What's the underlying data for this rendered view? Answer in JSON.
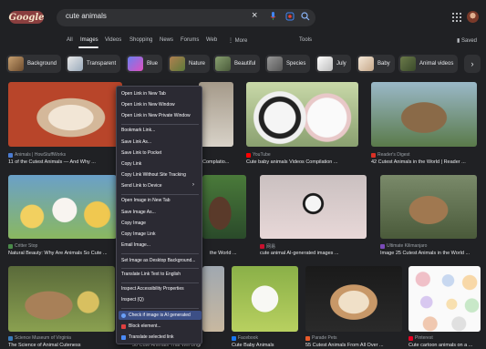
{
  "header": {
    "logo": "Google",
    "search_query": "cute animals",
    "clear_label": "×",
    "tools": "Tools",
    "saved": "Saved"
  },
  "nav": {
    "tabs": [
      "All",
      "Images",
      "Videos",
      "Shopping",
      "News",
      "Forums",
      "Web",
      "⋮ More"
    ],
    "active": "Images"
  },
  "chips": [
    "Background",
    "Transparent",
    "Blue",
    "Nature",
    "Beautiful",
    "Species",
    "July",
    "Baby",
    "Animal videos"
  ],
  "results": [
    {
      "source": "Animals | HowStuffWorks",
      "title": "11 of the Cutest Animals — And Why ..."
    },
    {
      "source": "",
      "title": "Complatio..."
    },
    {
      "source": "YouTube",
      "title": "Cute baby animals Videos Compilation ..."
    },
    {
      "source": "Reader's Digest",
      "title": "42 Cutest Animals in the World | Reader ..."
    },
    {
      "source": "Critter Stop",
      "title": "Natural Beauty: Why Are Animals So Cute ..."
    },
    {
      "source": "",
      "title": "the World ..."
    },
    {
      "source": "网易",
      "title": "cute animal AI-generated images ..."
    },
    {
      "source": "Ultimate Kilimanjaro",
      "title": "Image 25 Cutest Animals in the World ..."
    },
    {
      "source": "Science Museum of Virginia",
      "title": "The Science of Animal Cuteness"
    },
    {
      "source": "",
      "title": "50 Cute Animals That Will Brighten ..."
    },
    {
      "source": "Facebook",
      "title": "Cute Baby Animals"
    },
    {
      "source": "Parade Pets",
      "title": "55 Cutest Animals From All Over ..."
    },
    {
      "source": "Pinterest",
      "title": "Cute cartoon animals on a ..."
    }
  ],
  "context_menu": {
    "items": [
      "Open Link in New Tab",
      "Open Link in New Window",
      "Open Link in New Private Window",
      "Bookmark Link...",
      "Save Link As...",
      "Save Link to Pocket",
      "Copy Link",
      "Copy Link Without Site Tracking",
      "Send Link to Device",
      "Open Image in New Tab",
      "Save Image As...",
      "Copy Image",
      "Copy Image Link",
      "Email Image...",
      "Set Image as Desktop Background...",
      "Translate Link Text to English",
      "Inspect Accessibility Properties",
      "Inspect (Q)",
      "Check if image is AI generated",
      "Block element...",
      "Translate selected link"
    ],
    "highlighted": "Check if image is AI generated"
  },
  "colors": {
    "background": "#202124",
    "menu_bg": "#2b2a33",
    "highlight": "#3c4f86",
    "text": "#e8eaed"
  }
}
